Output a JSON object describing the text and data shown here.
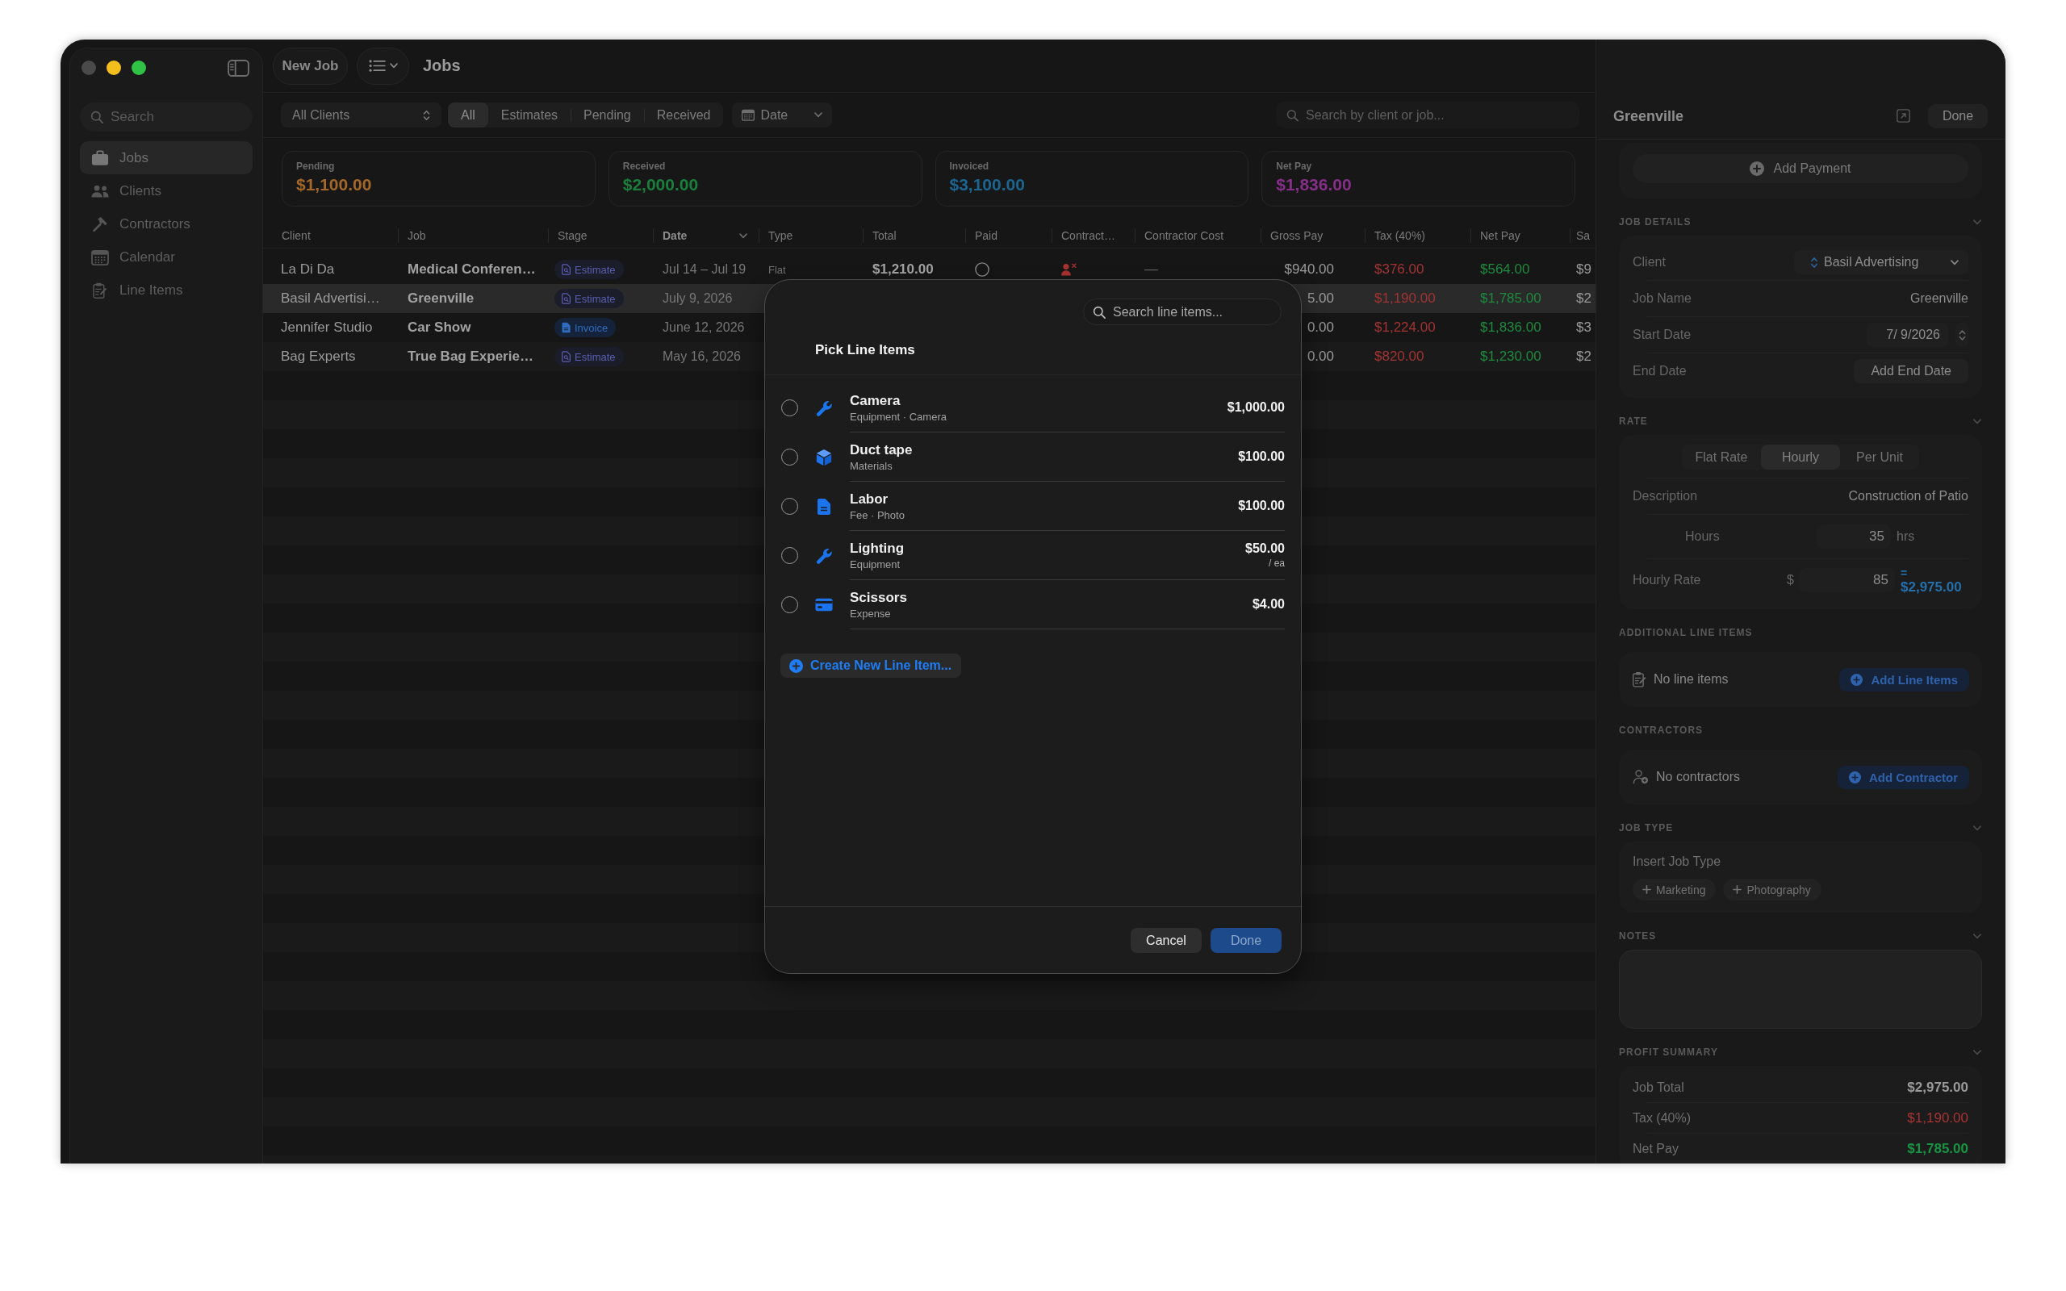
{
  "window": {
    "title": "Jobs",
    "new_job_button": "New Job"
  },
  "sidebar": {
    "search": {
      "placeholder": "Search"
    },
    "items": [
      {
        "label": "Jobs",
        "kind": "jobs",
        "selected": true
      },
      {
        "label": "Clients",
        "kind": "clients",
        "selected": false
      },
      {
        "label": "Contractors",
        "kind": "contractors",
        "selected": false
      },
      {
        "label": "Calendar",
        "kind": "calendar",
        "selected": false
      },
      {
        "label": "Line Items",
        "kind": "line_items",
        "selected": false
      }
    ]
  },
  "filters": {
    "client_filter": "All Clients",
    "segments": [
      {
        "label": "All",
        "selected": true
      },
      {
        "label": "Estimates",
        "selected": false
      },
      {
        "label": "Pending",
        "selected": false
      },
      {
        "label": "Received",
        "selected": false
      }
    ],
    "date_button": "Date",
    "search": {
      "placeholder": "Search by client or job..."
    }
  },
  "summary_cards": [
    {
      "label": "Pending",
      "value": "$1,100.00",
      "color": "#a3672a"
    },
    {
      "label": "Received",
      "value": "$2,000.00",
      "color": "#1a7f3c"
    },
    {
      "label": "Invoiced",
      "value": "$3,100.00",
      "color": "#1c6591"
    },
    {
      "label": "Net Pay",
      "value": "$1,836.00",
      "color": "#852f88"
    }
  ],
  "table": {
    "columns": [
      {
        "label": "Client",
        "sorted": false
      },
      {
        "label": "Job",
        "sorted": false
      },
      {
        "label": "Stage",
        "sorted": false
      },
      {
        "label": "Date",
        "sorted": true
      },
      {
        "label": "Type",
        "sorted": false
      },
      {
        "label": "Total",
        "sorted": false
      },
      {
        "label": "Paid",
        "sorted": false
      },
      {
        "label": "Contract…",
        "sorted": false
      },
      {
        "label": "Contractor Cost",
        "sorted": false
      },
      {
        "label": "Gross Pay",
        "sorted": false
      },
      {
        "label": "Tax (40%)",
        "sorted": false
      },
      {
        "label": "Net Pay",
        "sorted": false
      },
      {
        "label": "Sa",
        "sorted": false
      }
    ],
    "rows": [
      {
        "selected": false,
        "client": "La Di Da",
        "job": "Medical Conferen…",
        "stage": {
          "label": "Estimate",
          "kind": "estimate"
        },
        "date": "Jul 14 – Jul 19",
        "type": "Flat",
        "total": "$1,210.00",
        "paid": false,
        "contractor_assigned": false,
        "contractor_cost": "—",
        "gross_pay": "$940.00",
        "tax": "$376.00",
        "net_pay": "$564.00",
        "column_13": "$9"
      },
      {
        "selected": true,
        "client": "Basil Advertisi…",
        "job": "Greenville",
        "stage": {
          "label": "Estimate",
          "kind": "estimate"
        },
        "date": "July 9, 2026",
        "gross_pay": "5.00",
        "tax": "$1,190.00",
        "net_pay": "$1,785.00",
        "column_13": "$2"
      },
      {
        "selected": false,
        "client": "Jennifer Studio",
        "job": "Car Show",
        "stage": {
          "label": "Invoice",
          "kind": "invoice"
        },
        "date": "June 12, 2026",
        "gross_pay": "0.00",
        "tax": "$1,224.00",
        "net_pay": "$1,836.00",
        "column_13": "$3"
      },
      {
        "selected": false,
        "client": "Bag Experts",
        "job": "True Bag Experie…",
        "stage": {
          "label": "Estimate",
          "kind": "estimate"
        },
        "date": "May 16, 2026",
        "gross_pay": "0.00",
        "tax": "$820.00",
        "net_pay": "$1,230.00",
        "column_13": "$2"
      }
    ]
  },
  "inspector": {
    "title": "Greenville",
    "done_button": "Done",
    "add_payment_button": "Add Payment",
    "sections": [
      {
        "kind": "details",
        "header": "JOB DETAILS",
        "collapsible": true,
        "rows": [
          {
            "kind": "popup",
            "label": "Client",
            "value": "Basil Advertising"
          },
          {
            "kind": "text",
            "label": "Job Name",
            "value": "Greenville"
          },
          {
            "kind": "date",
            "label": "Start Date",
            "value": "7/ 9/2026"
          },
          {
            "kind": "button",
            "label": "End Date",
            "value": "Add End Date"
          }
        ]
      },
      {
        "kind": "rate",
        "header": "RATE",
        "collapsible": true,
        "modes": [
          {
            "label": "Flat Rate",
            "selected": false
          },
          {
            "label": "Hourly",
            "selected": true
          },
          {
            "label": "Per Unit",
            "selected": false
          }
        ],
        "rows": [
          {
            "kind": "text",
            "label": "Description",
            "value": "Construction of Patio"
          },
          {
            "kind": "quantity",
            "label": "Hours",
            "value": "35",
            "unit": "hrs"
          },
          {
            "kind": "rate",
            "label": "Hourly Rate",
            "currency": "$",
            "value": "85",
            "equals": "=",
            "result": "$2,975.00"
          }
        ]
      },
      {
        "kind": "line_items",
        "header": "ADDITIONAL LINE ITEMS",
        "collapsible": false,
        "empty_text": "No line items",
        "add_button": "Add Line Items"
      },
      {
        "kind": "contractors",
        "header": "CONTRACTORS",
        "collapsible": false,
        "empty_text": "No contractors",
        "add_button": "Add Contractor"
      },
      {
        "kind": "job_type",
        "header": "JOB TYPE",
        "collapsible": true,
        "placeholder": "Insert Job Type",
        "suggestions": [
          "Marketing",
          "Photography"
        ]
      },
      {
        "kind": "notes",
        "header": "NOTES",
        "collapsible": true
      },
      {
        "kind": "summary",
        "header": "PROFIT SUMMARY",
        "collapsible": true,
        "rows": [
          {
            "kind": "total",
            "label": "Job Total",
            "value": "$2,975.00"
          },
          {
            "kind": "tax",
            "label": "Tax (40%)",
            "value": "$1,190.00"
          },
          {
            "kind": "net",
            "label": "Net Pay",
            "value": "$1,785.00"
          }
        ]
      }
    ]
  },
  "line_item_picker": {
    "search": {
      "placeholder": "Search line items..."
    },
    "title": "Pick Line Items",
    "items": [
      {
        "name": "Camera",
        "detail": "Equipment · Camera",
        "price": "$1,000.00",
        "kind": "equipment",
        "selected": false
      },
      {
        "name": "Duct tape",
        "detail": "Materials",
        "price": "$100.00",
        "kind": "materials",
        "selected": false
      },
      {
        "name": "Labor",
        "detail": "Fee · Photo",
        "price": "$100.00",
        "kind": "fee",
        "selected": false
      },
      {
        "name": "Lighting",
        "detail": "Equipment",
        "price": "$50.00",
        "unit": "/ ea",
        "kind": "equipment",
        "selected": false
      },
      {
        "name": "Scissors",
        "detail": "Expense",
        "price": "$4.00",
        "kind": "expense",
        "selected": false
      }
    ],
    "create_button": "Create New Line Item...",
    "cancel_button": "Cancel",
    "done_button": {
      "label": "Done",
      "disabled": true
    }
  }
}
